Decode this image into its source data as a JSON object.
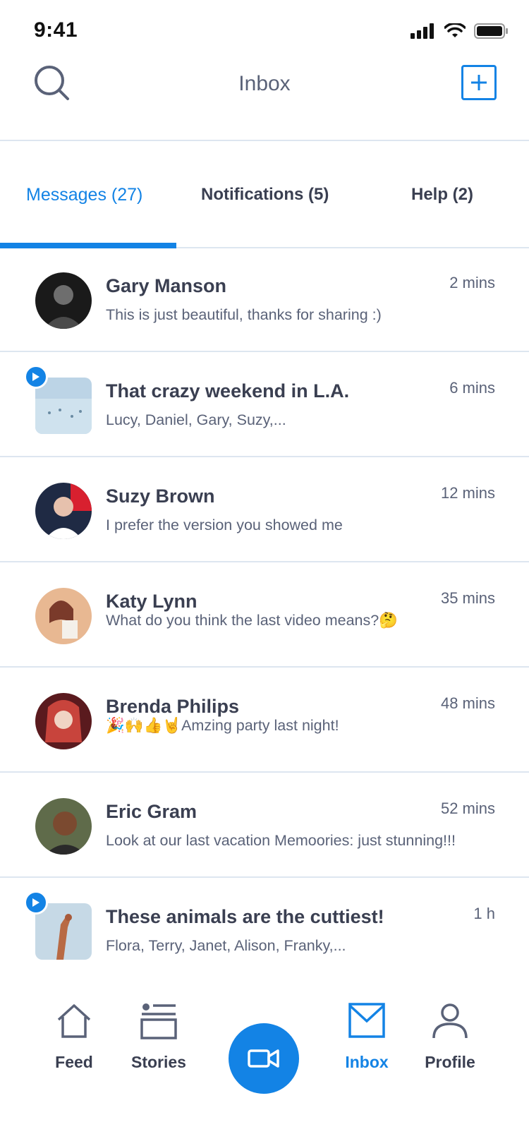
{
  "status_bar": {
    "time": "9:41"
  },
  "header": {
    "title": "Inbox"
  },
  "tabs": [
    {
      "label": "Messages (27)",
      "active": true
    },
    {
      "label": "Notifications (5)",
      "active": false
    },
    {
      "label": "Help (2)",
      "active": false
    }
  ],
  "messages": [
    {
      "name": "Gary Manson",
      "preview": "This is just beautiful, thanks for sharing :)",
      "time": "2 mins",
      "kind": "avatar"
    },
    {
      "name": "That crazy weekend in L.A.",
      "preview": "Lucy, Daniel, Gary, Suzy,...",
      "time": "6 mins",
      "kind": "video"
    },
    {
      "name": "Suzy Brown",
      "preview": "I prefer the version you showed me",
      "time": "12 mins",
      "kind": "avatar"
    },
    {
      "name": "Katy Lynn",
      "preview": "What do you think the last video means?🤔",
      "time": "35 mins",
      "kind": "avatar"
    },
    {
      "name": "Brenda Philips",
      "preview": "🎉🙌👍🤘Amzing party last night!",
      "time": "48 mins",
      "kind": "avatar"
    },
    {
      "name": "Eric Gram",
      "preview": "Look at our last vacation Memoories: just stunning!!!",
      "time": "52 mins",
      "kind": "avatar"
    },
    {
      "name": "These animals are the cuttiest!",
      "preview": "Flora, Terry, Janet, Alison, Franky,...",
      "time": "1 h",
      "kind": "video"
    }
  ],
  "bottom_nav": {
    "items": [
      {
        "label": "Feed",
        "icon": "home-icon"
      },
      {
        "label": "Stories",
        "icon": "stories-icon"
      },
      {
        "label": "Inbox",
        "icon": "envelope-icon",
        "active": true
      },
      {
        "label": "Profile",
        "icon": "person-icon"
      }
    ],
    "center_icon": "video-camera-icon"
  },
  "colors": {
    "accent": "#1383e5",
    "text": "#3a3f51",
    "muted": "#5a6278",
    "divider": "#dde6f0"
  }
}
